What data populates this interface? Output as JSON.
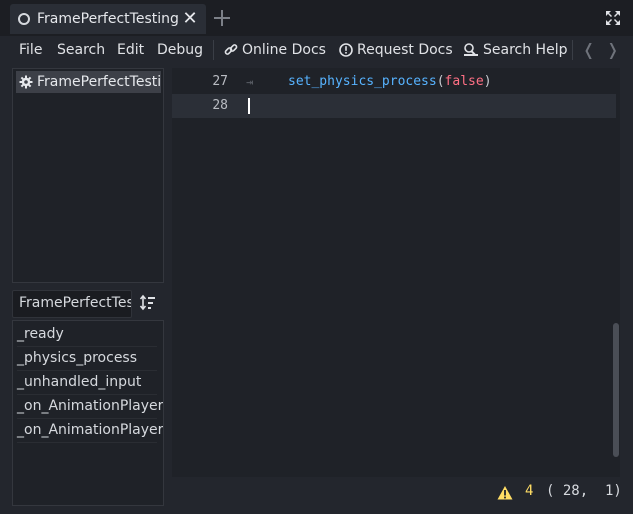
{
  "tab": {
    "title": "FramePerfectTesting",
    "close_glyph": "✕"
  },
  "menu": {
    "file": "File",
    "search": "Search",
    "edit": "Edit",
    "debug": "Debug",
    "online_docs": "Online Docs",
    "request_docs": "Request Docs",
    "search_help": "Search Help",
    "back_glyph": "❬",
    "forward_glyph": "❭"
  },
  "scripts": {
    "items": [
      {
        "label": "FramePerfectTesting"
      }
    ]
  },
  "methods": {
    "filter_value": "FramePerfectTesting",
    "items": [
      "_ready",
      "_physics_process",
      "_unhandled_input",
      "_on_AnimationPlayer_animation_finished",
      "_on_AnimationPlayer_animation_started"
    ]
  },
  "editor": {
    "lines": [
      {
        "number": "27",
        "fold": "⇥",
        "func": "set_physics_process",
        "open": "(",
        "arg": "false",
        "close": ")"
      },
      {
        "number": "28"
      }
    ]
  },
  "status": {
    "warnings": "4",
    "position": "( 28,  1)"
  },
  "colors": {
    "function": "#57b3ff",
    "keyword": "#ff7085",
    "warning": "#ffdd65"
  }
}
